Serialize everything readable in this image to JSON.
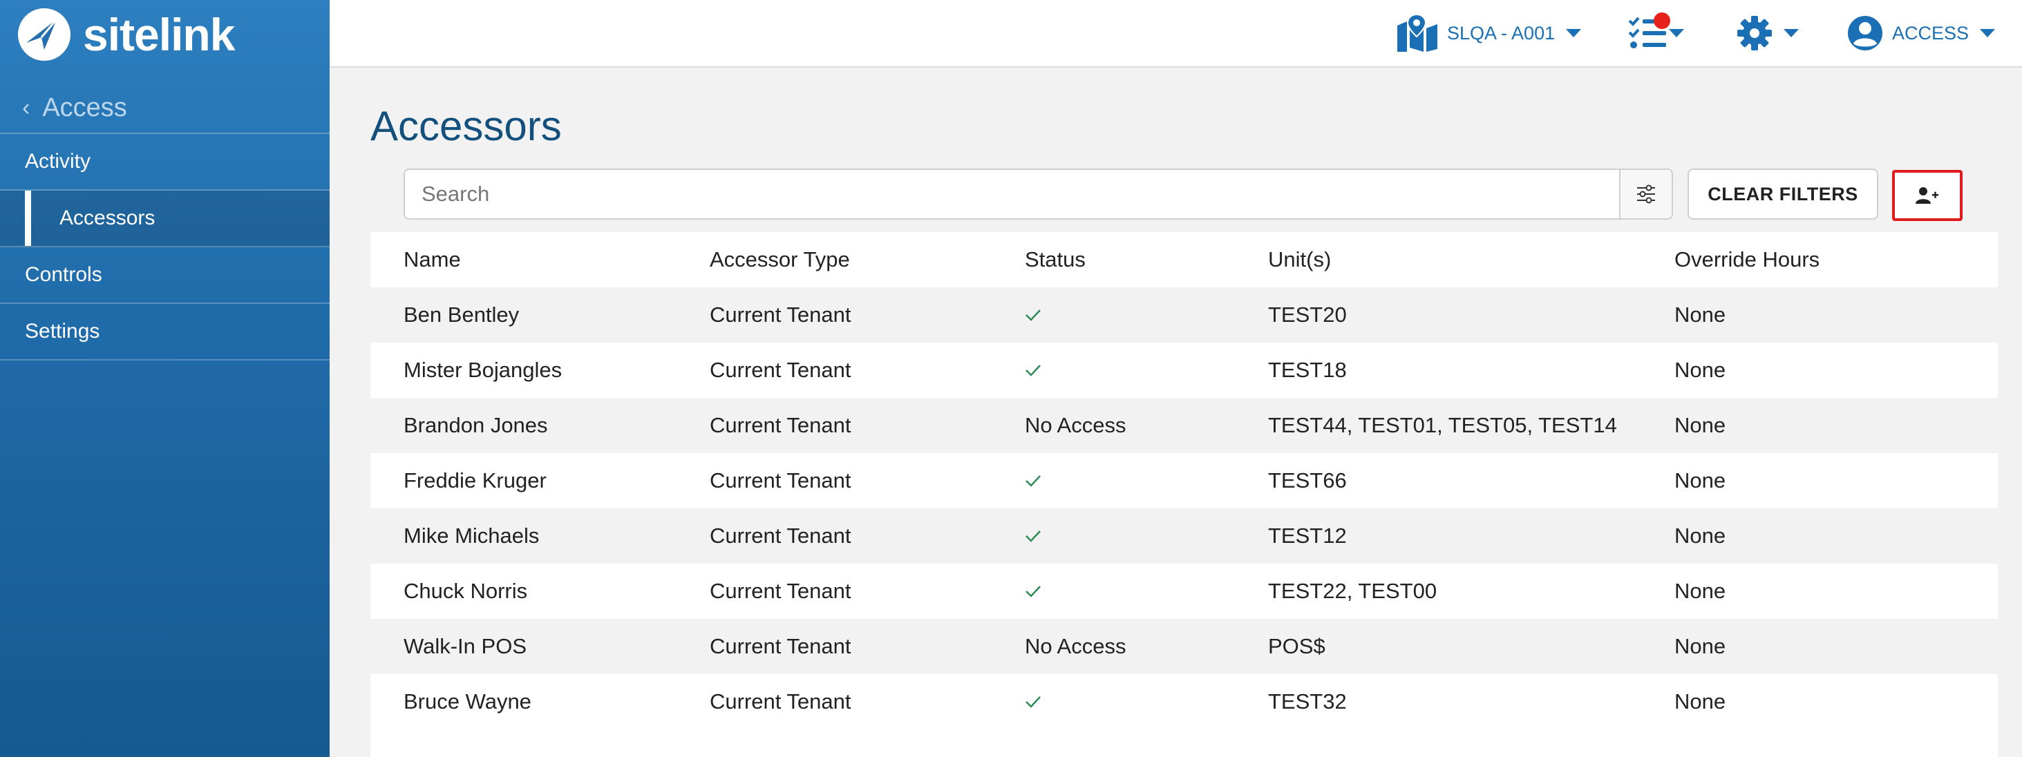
{
  "brand": {
    "name": "sitelink"
  },
  "sidebar": {
    "back_label": "Access",
    "items": [
      {
        "label": "Activity"
      },
      {
        "label": "Accessors",
        "active": true
      },
      {
        "label": "Controls"
      },
      {
        "label": "Settings"
      }
    ]
  },
  "topbar": {
    "location_label": "SLQA - A001",
    "user_label": "ACCESS",
    "icons": [
      "map-icon",
      "tasks-icon",
      "gear-icon",
      "user-circle-icon"
    ]
  },
  "page": {
    "title": "Accessors"
  },
  "toolbar": {
    "search_placeholder": "Search",
    "search_value": "",
    "clear_filters_label": "CLEAR FILTERS"
  },
  "table": {
    "columns": [
      "Name",
      "Accessor Type",
      "Status",
      "Unit(s)",
      "Override Hours"
    ],
    "rows": [
      {
        "name": "Ben Bentley",
        "type": "Current Tenant",
        "status": "",
        "has_access": true,
        "units": "TEST20",
        "override": "None"
      },
      {
        "name": "Mister Bojangles",
        "type": "Current Tenant",
        "status": "",
        "has_access": true,
        "units": "TEST18",
        "override": "None"
      },
      {
        "name": "Brandon Jones",
        "type": "Current Tenant",
        "status": "No Access",
        "has_access": false,
        "units": "TEST44, TEST01, TEST05, TEST14",
        "override": "None"
      },
      {
        "name": "Freddie Kruger",
        "type": "Current Tenant",
        "status": "",
        "has_access": true,
        "units": "TEST66",
        "override": "None"
      },
      {
        "name": "Mike Michaels",
        "type": "Current Tenant",
        "status": "",
        "has_access": true,
        "units": "TEST12",
        "override": "None"
      },
      {
        "name": "Chuck Norris",
        "type": "Current Tenant",
        "status": "",
        "has_access": true,
        "units": "TEST22, TEST00",
        "override": "None"
      },
      {
        "name": "Walk-In POS",
        "type": "Current Tenant",
        "status": "No Access",
        "has_access": false,
        "units": "POS$",
        "override": "None"
      },
      {
        "name": "Bruce Wayne",
        "type": "Current Tenant",
        "status": "",
        "has_access": true,
        "units": "TEST32",
        "override": "None"
      }
    ]
  },
  "colors": {
    "brand_blue": "#1f6aa8",
    "title_blue": "#14507d",
    "check_green": "#2e8b57",
    "highlight_red": "#e01b1b",
    "notification_red": "#e8221b"
  }
}
